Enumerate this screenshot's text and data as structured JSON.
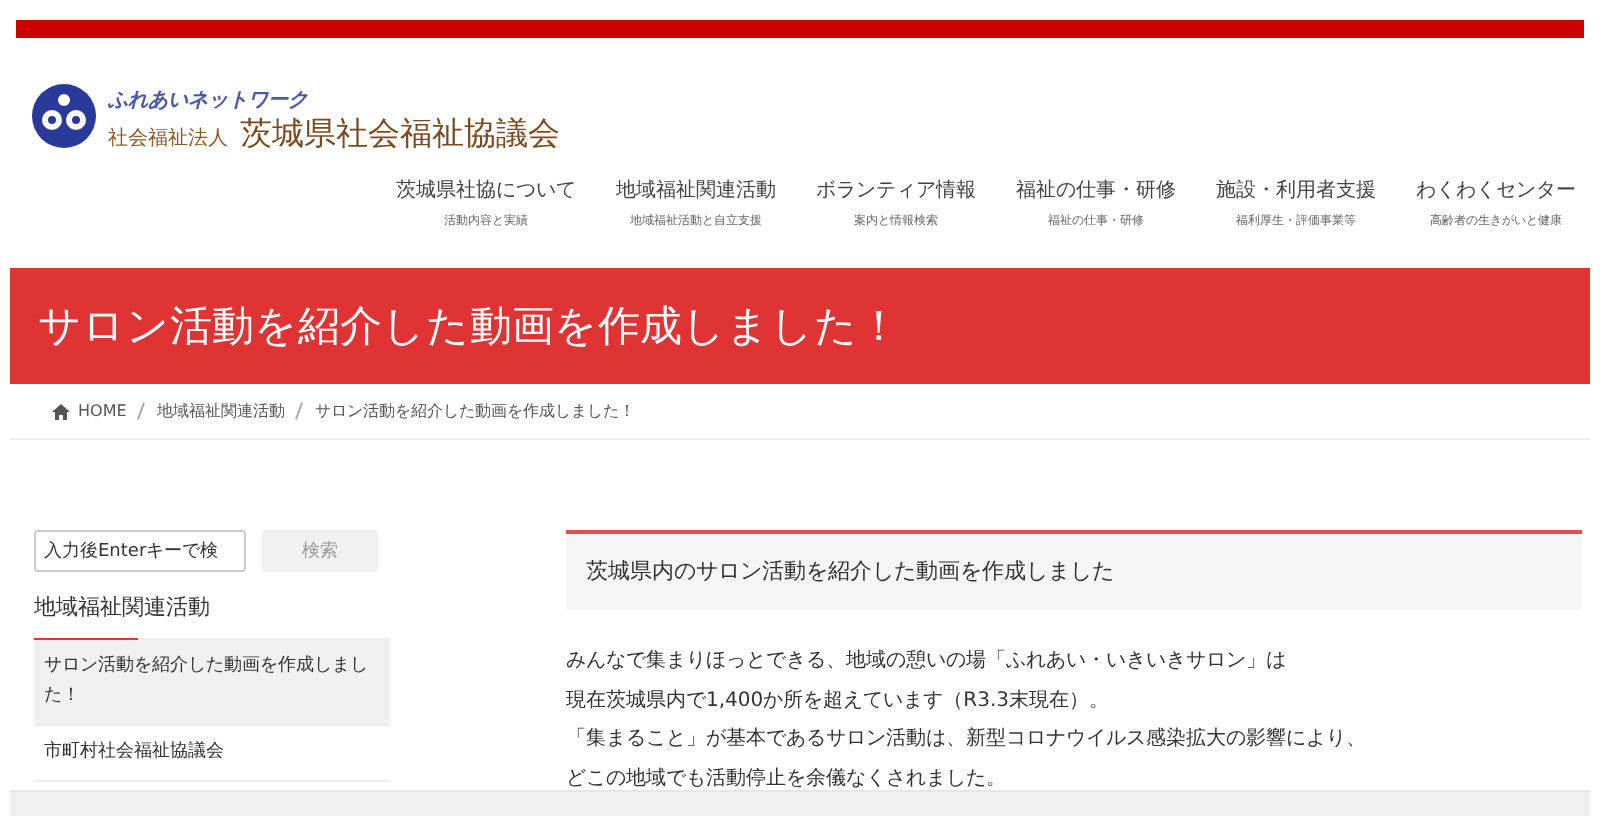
{
  "header": {
    "tagline": "ふれあいネットワーク",
    "corp_type": "社会福祉法人",
    "org_name": "茨城県社会福祉協議会"
  },
  "nav": [
    {
      "label": "茨城県社協について",
      "sub": "活動内容と実績"
    },
    {
      "label": "地域福祉関連活動",
      "sub": "地域福祉活動と自立支援"
    },
    {
      "label": "ボランティア情報",
      "sub": "案内と情報検索"
    },
    {
      "label": "福祉の仕事・研修",
      "sub": "福祉の仕事・研修"
    },
    {
      "label": "施設・利用者支援",
      "sub": "福利厚生・評価事業等"
    },
    {
      "label": "わくわくセンター",
      "sub": "高齢者の生きがいと健康"
    }
  ],
  "page_title": "サロン活動を紹介した動画を作成しました！",
  "breadcrumb": [
    "HOME",
    "地域福祉関連活動",
    "サロン活動を紹介した動画を作成しました！"
  ],
  "search": {
    "placeholder": "入力後Enterキーで検",
    "button": "検索"
  },
  "sidebar": {
    "heading": "地域福祉関連活動",
    "items": [
      {
        "label": "サロン活動を紹介した動画を作成しました！",
        "selected": true
      },
      {
        "label": "市町村社会福祉協議会",
        "selected": false
      }
    ]
  },
  "article": {
    "heading": "茨城県内のサロン活動を紹介した動画を作成しました",
    "paragraphs": [
      "みんなで集まりほっとできる、地域の憩いの場「ふれあい・いきいきサロン」は",
      "現在茨城県内で1,400か所を超えています（R3.3末現在）。",
      "「集まること」が基本であるサロン活動は、新型コロナウイルス感染拡大の影響により、",
      "どこの地域でも活動停止を余儀なくされました。"
    ]
  }
}
